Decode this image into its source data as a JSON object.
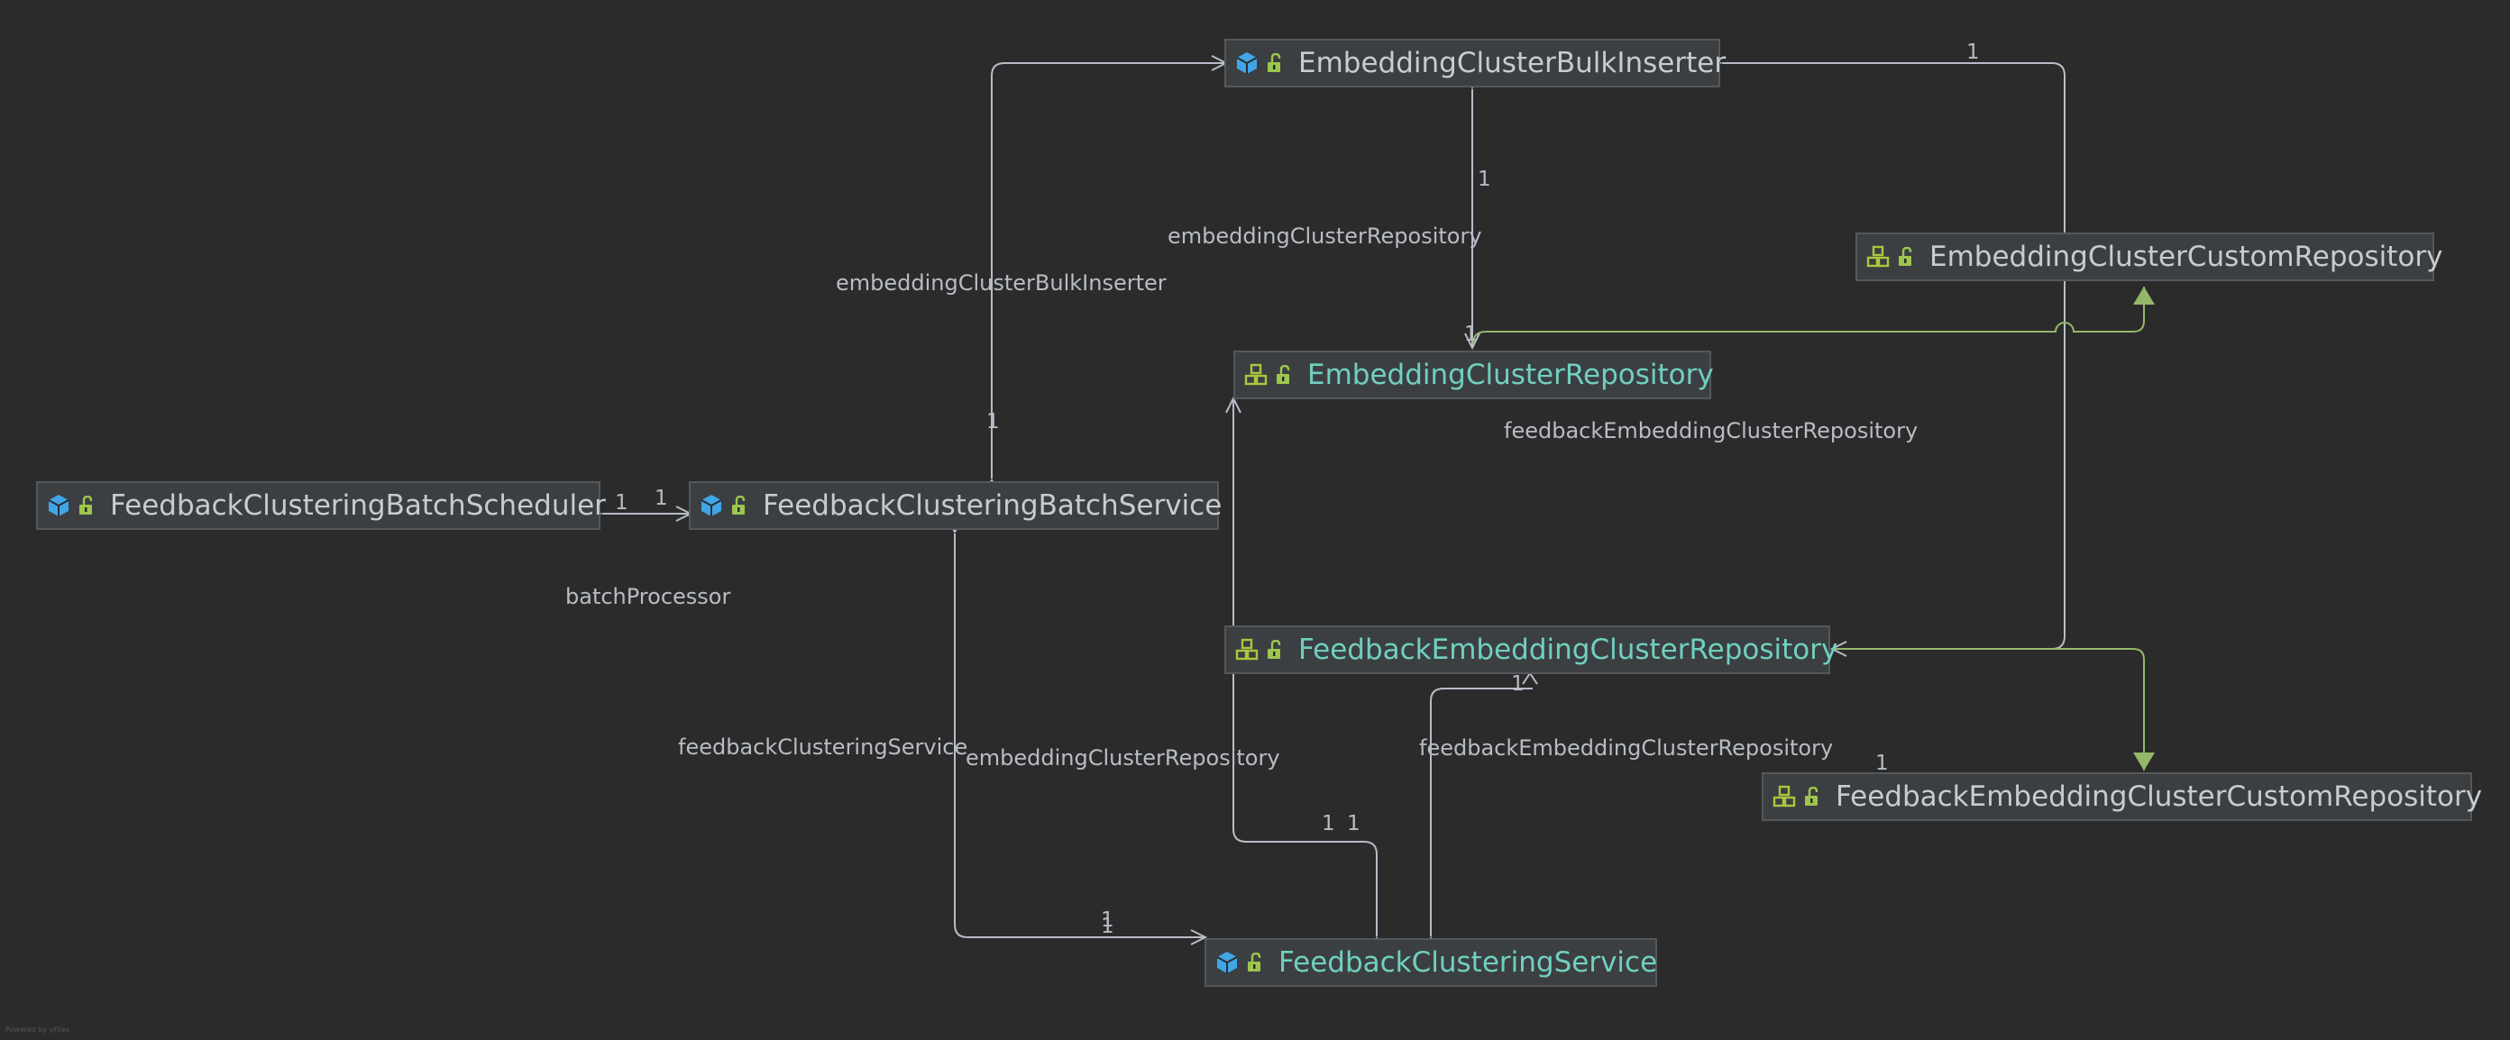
{
  "colors": {
    "background": "#2b2b2b",
    "edge": "#b8bcc8",
    "realization": "#94b86a",
    "class_icon": "#3fa6e8",
    "interface_icon": "#a8c83f",
    "lock_icon": "#9cc64e",
    "name_plain": "#c8ccd0",
    "name_teal": "#70d0c0"
  },
  "nodes": {
    "scheduler": {
      "name": "FeedbackClusteringBatchScheduler",
      "kind": "class",
      "icon": "class-icon"
    },
    "batch_service": {
      "name": "FeedbackClusteringBatchService",
      "kind": "class",
      "icon": "class-icon"
    },
    "bulk_inserter": {
      "name": "EmbeddingClusterBulkInserter",
      "kind": "class",
      "icon": "class-icon"
    },
    "custom_repo": {
      "name": "EmbeddingClusterCustomRepository",
      "kind": "interface",
      "icon": "interface-icon"
    },
    "cluster_repo": {
      "name": "EmbeddingClusterRepository",
      "kind": "interface",
      "icon": "interface-icon"
    },
    "fec_repo": {
      "name": "FeedbackEmbeddingClusterRepository",
      "kind": "interface",
      "icon": "interface-icon"
    },
    "fec_custom_repo": {
      "name": "FeedbackEmbeddingClusterCustomRepository",
      "kind": "interface",
      "icon": "interface-icon"
    },
    "clustering_service": {
      "name": "FeedbackClusteringService",
      "kind": "class",
      "icon": "class-icon"
    }
  },
  "edge_labels": {
    "bulk_inserter_field": "embeddingClusterBulkInserter",
    "cluster_repo_field_top": "embeddingClusterRepository",
    "fec_repo_field_top": "feedbackEmbeddingClusterRepository",
    "batch_processor": "batchProcessor",
    "clustering_service_field": "feedbackClusteringService",
    "cluster_repo_field_bottom": "embeddingClusterRepository",
    "fec_repo_field_bottom": "feedbackEmbeddingClusterRepository"
  },
  "multiplicity": "1",
  "footer": "Powered by yFiles"
}
